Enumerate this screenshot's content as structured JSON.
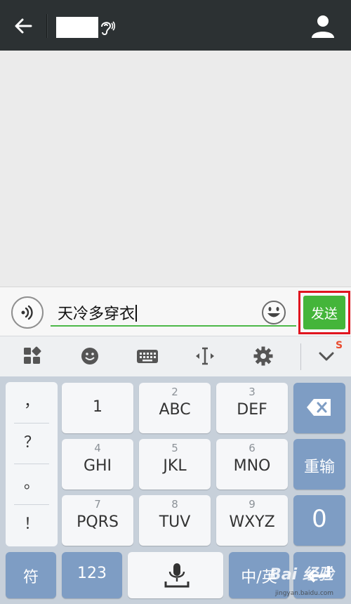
{
  "header": {
    "back_icon": "arrow-left-icon",
    "earpiece_icon": "ear-icon",
    "profile_icon": "person-icon"
  },
  "compose": {
    "voice_icon": "voice-wave-icon",
    "text_value": "天冷多穿衣",
    "emoji_icon": "smiley-icon",
    "send_label": "发送"
  },
  "ime_toolbar": {
    "tools": [
      "grid-icon",
      "smiley-icon",
      "keyboard-icon",
      "cursor-icon",
      "gear-icon",
      "chevron-down-icon"
    ],
    "brand": "S"
  },
  "keyboard": {
    "symbols": [
      "，",
      "？",
      "。",
      "！"
    ],
    "keys": [
      {
        "num": "",
        "label": "1"
      },
      {
        "num": "2",
        "label": "ABC"
      },
      {
        "num": "3",
        "label": "DEF"
      },
      {
        "num": "4",
        "label": "GHI"
      },
      {
        "num": "5",
        "label": "JKL"
      },
      {
        "num": "6",
        "label": "MNO"
      },
      {
        "num": "7",
        "label": "PQRS"
      },
      {
        "num": "8",
        "label": "TUV"
      },
      {
        "num": "9",
        "label": "WXYZ"
      }
    ],
    "delete_icon": "backspace-icon",
    "retype_label": "重输",
    "zero_label": "0",
    "symbol_key": "符",
    "num_key": "123",
    "space_icon": "microphone-icon",
    "lang_key": "中/英",
    "enter_icon": "enter-icon"
  },
  "watermark": {
    "logo": "Bai 经验",
    "url": "jingyan.baidu.com"
  },
  "colors": {
    "header_bg": "#2c3133",
    "send_green": "#44b53a",
    "highlight_red": "#e0151f",
    "key_blue": "#7e9dc4"
  }
}
